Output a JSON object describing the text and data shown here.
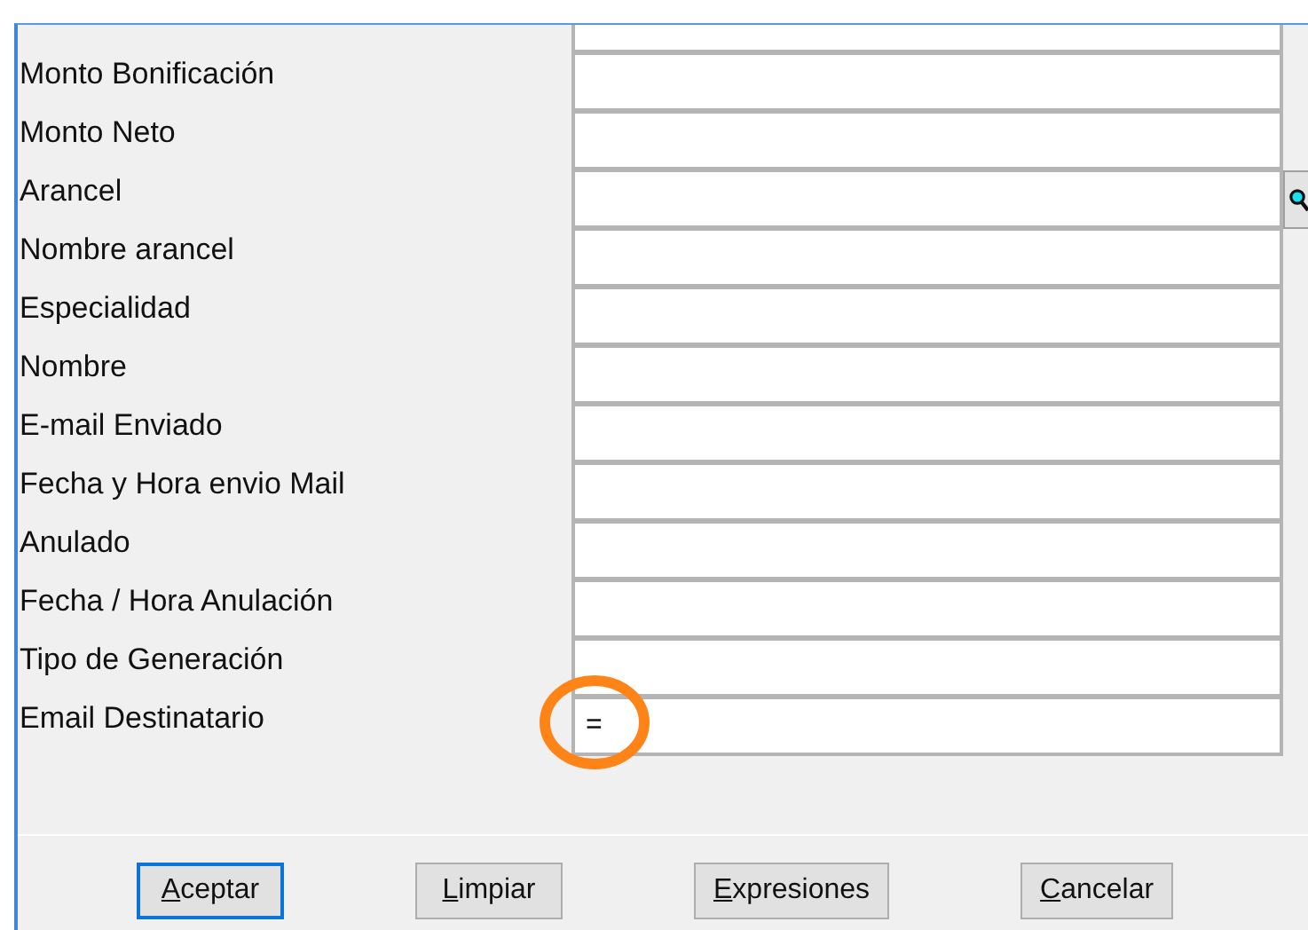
{
  "fields": [
    {
      "label": "Monto Bonificación",
      "lookup": false,
      "highlighted": false
    },
    {
      "label": "Monto Neto",
      "lookup": false,
      "highlighted": false
    },
    {
      "label": "Arancel",
      "lookup": true,
      "highlighted": false
    },
    {
      "label": "Nombre arancel",
      "lookup": false,
      "highlighted": false
    },
    {
      "label": "Especialidad",
      "lookup": false,
      "highlighted": false
    },
    {
      "label": "Nombre",
      "lookup": false,
      "highlighted": false
    },
    {
      "label": "E-mail Enviado",
      "lookup": false,
      "highlighted": false
    },
    {
      "label": "Fecha y Hora envio Mail",
      "lookup": false,
      "highlighted": false
    },
    {
      "label": "Anulado",
      "lookup": false,
      "highlighted": false
    },
    {
      "label": "Fecha / Hora Anulación",
      "lookup": false,
      "highlighted": false
    },
    {
      "label": "Tipo de Generación",
      "lookup": false,
      "highlighted": false
    },
    {
      "label": "Email Destinatario",
      "value": "=",
      "lookup": false,
      "highlighted": true
    }
  ],
  "buttons": [
    {
      "label": "Aceptar",
      "default": true
    },
    {
      "label": "Limpiar",
      "default": false
    },
    {
      "label": "Expresiones",
      "default": false
    },
    {
      "label": "Cancelar",
      "default": false
    }
  ]
}
